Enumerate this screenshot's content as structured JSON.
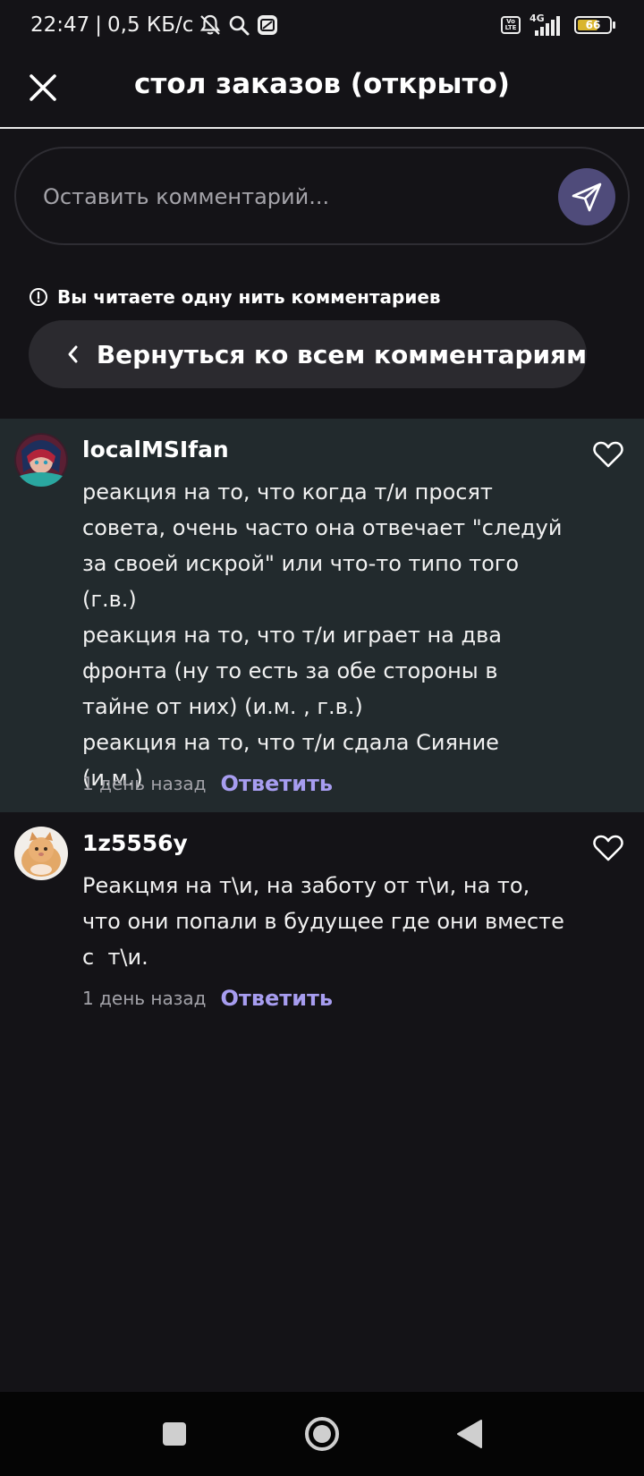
{
  "status_bar": {
    "time": "22:47",
    "separator": "|",
    "speed": "0,5 КБ/с",
    "volte_top": "Vo",
    "volte_bottom": "LTE",
    "network": "4G",
    "battery": "66",
    "battery_level": 0.66,
    "icons": [
      "bell-off-icon",
      "search-icon",
      "app-notification-icon",
      "volte-icon",
      "signal-4g-icon",
      "battery-icon"
    ]
  },
  "header": {
    "title": "стол заказов (открыто)",
    "close_icon": "close-icon"
  },
  "comment_box": {
    "placeholder": "Оставить комментарий...",
    "value": "",
    "send_icon": "send-icon"
  },
  "thread": {
    "notice": "Вы читаете одну нить комментариев",
    "notice_icon": "info-icon",
    "back_label": "Вернуться ко всем комментариям"
  },
  "comments": [
    {
      "username": "localMSIfan",
      "text": "реакция на то, что когда т/и просят\nсовета, очень часто она отвечает \"следуй\nза своей искрой\" или что-то типо того\n(г.в.)\nреакция на то, что т/и играет на два\nфронта (ну то есть за обе стороны в\nтайне от них) (и.м. , г.в.)\nреакция на то, что т/и сдала Сияние (и.м.)",
      "time": "1 день назад",
      "reply_label": "Ответить",
      "highlighted": true
    },
    {
      "username": "1z5556y",
      "text": "Реакцмя на т\\и, на заботу от т\\и, на то,\nчто они попали в будущее где они вместе\nс  т\\и.",
      "time": "1 день назад",
      "reply_label": "Ответить",
      "highlighted": false
    }
  ],
  "colors": {
    "background": "#141317",
    "highlight": "#222a2d",
    "accent": "#a79df0",
    "send_button": "#4f4b7a",
    "pill": "#2b2a2f"
  },
  "nav_bar": {
    "buttons": [
      "recents-square-icon",
      "home-circle-icon",
      "back-triangle-icon"
    ]
  }
}
